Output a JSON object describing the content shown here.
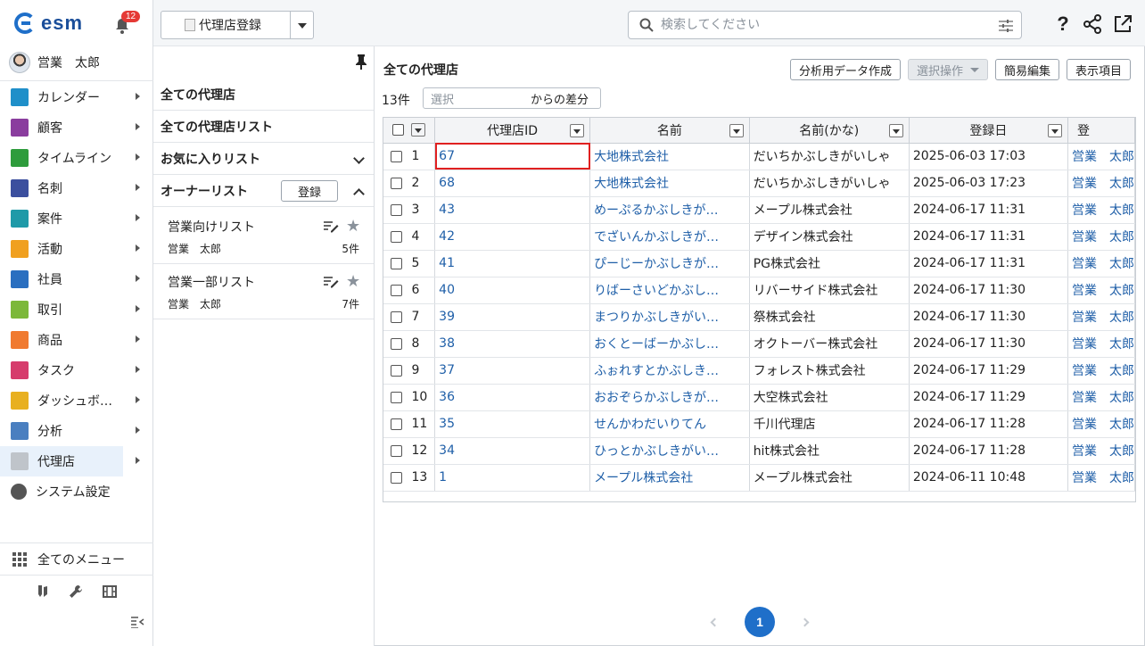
{
  "app": {
    "logo_text": "esm",
    "notification_count": "12",
    "user_name": "営業　太郎"
  },
  "sidebar": {
    "items": [
      {
        "label": "カレンダー",
        "icon": "calendar-icon",
        "color": "#1f8fc9"
      },
      {
        "label": "顧客",
        "icon": "building-icon",
        "color": "#8a3d9e"
      },
      {
        "label": "タイムライン",
        "icon": "chat-icon",
        "color": "#2e9c3c"
      },
      {
        "label": "名刺",
        "icon": "card-icon",
        "color": "#3b4f9e"
      },
      {
        "label": "案件",
        "icon": "folder-icon",
        "color": "#1f9aa8"
      },
      {
        "label": "活動",
        "icon": "clipboard-icon",
        "color": "#f0a020"
      },
      {
        "label": "社員",
        "icon": "person-icon",
        "color": "#2a6fc0"
      },
      {
        "label": "取引",
        "icon": "ledger-icon",
        "color": "#7cb83a"
      },
      {
        "label": "商品",
        "icon": "box-icon",
        "color": "#f07a30"
      },
      {
        "label": "タスク",
        "icon": "check-icon",
        "color": "#d63c6c"
      },
      {
        "label": "ダッシュボ…",
        "icon": "dashboard-icon",
        "color": "#e8b020"
      },
      {
        "label": "分析",
        "icon": "chart-icon",
        "color": "#4a7fc0"
      },
      {
        "label": "代理店",
        "icon": "document-icon",
        "color": "#bfc4ca"
      },
      {
        "label": "システム設定",
        "icon": "gear-icon",
        "color": "#555555"
      }
    ],
    "all_menu_label": "全てのメニュー"
  },
  "topbar": {
    "register_label": "代理店登録",
    "search_placeholder": "検索してください"
  },
  "list_panel": {
    "all_label": "全ての代理店",
    "all_list_label": "全ての代理店リスト",
    "favorites_label": "お気に入りリスト",
    "owner_label": "オーナーリスト",
    "owner_button": "登録",
    "lists": [
      {
        "title": "営業向けリスト",
        "owner": "営業　太郎",
        "count": "5件"
      },
      {
        "title": "営業一部リスト",
        "owner": "営業　太郎",
        "count": "7件"
      }
    ]
  },
  "main": {
    "title": "全ての代理店",
    "buttons": [
      "分析用データ作成",
      "選択操作",
      "簡易編集",
      "表示項目"
    ],
    "count": "13件",
    "diff_placeholder": "選択",
    "diff_suffix": "からの差分",
    "columns": [
      "代理店ID",
      "名前",
      "名前(かな)",
      "登録日",
      "登"
    ],
    "rows": [
      {
        "n": "1",
        "id": "67",
        "name": "大地株式会社",
        "kana": "だいちかぶしきがいしゃ",
        "date": "2025-06-03 17:03",
        "owner": "営業　太郎"
      },
      {
        "n": "2",
        "id": "68",
        "name": "大地株式会社",
        "kana": "だいちかぶしきがいしゃ",
        "date": "2025-06-03 17:23",
        "owner": "営業　太郎"
      },
      {
        "n": "3",
        "id": "43",
        "name": "めーぷるかぶしきが…",
        "kana": "メープル株式会社",
        "date": "2024-06-17 11:31",
        "owner": "営業　太郎"
      },
      {
        "n": "4",
        "id": "42",
        "name": "でざいんかぶしきが…",
        "kana": "デザイン株式会社",
        "date": "2024-06-17 11:31",
        "owner": "営業　太郎"
      },
      {
        "n": "5",
        "id": "41",
        "name": "ぴーじーかぶしきが…",
        "kana": "PG株式会社",
        "date": "2024-06-17 11:31",
        "owner": "営業　太郎"
      },
      {
        "n": "6",
        "id": "40",
        "name": "りばーさいどかぶし…",
        "kana": "リバーサイド株式会社",
        "date": "2024-06-17 11:30",
        "owner": "営業　太郎"
      },
      {
        "n": "7",
        "id": "39",
        "name": "まつりかぶしきがい…",
        "kana": "祭株式会社",
        "date": "2024-06-17 11:30",
        "owner": "営業　太郎"
      },
      {
        "n": "8",
        "id": "38",
        "name": "おくとーばーかぶし…",
        "kana": "オクトーバー株式会社",
        "date": "2024-06-17 11:30",
        "owner": "営業　太郎"
      },
      {
        "n": "9",
        "id": "37",
        "name": "ふぉれすとかぶしき…",
        "kana": "フォレスト株式会社",
        "date": "2024-06-17 11:29",
        "owner": "営業　太郎"
      },
      {
        "n": "10",
        "id": "36",
        "name": "おおぞらかぶしきが…",
        "kana": "大空株式会社",
        "date": "2024-06-17 11:29",
        "owner": "営業　太郎"
      },
      {
        "n": "11",
        "id": "35",
        "name": "せんかわだいりてん",
        "kana": "千川代理店",
        "date": "2024-06-17 11:28",
        "owner": "営業　太郎"
      },
      {
        "n": "12",
        "id": "34",
        "name": "ひっとかぶしきがい…",
        "kana": "hit株式会社",
        "date": "2024-06-17 11:28",
        "owner": "営業　太郎"
      },
      {
        "n": "13",
        "id": "1",
        "name": "メープル株式会社",
        "kana": "メープル株式会社",
        "date": "2024-06-11 10:48",
        "owner": "営業　太郎"
      }
    ],
    "page": "1"
  }
}
